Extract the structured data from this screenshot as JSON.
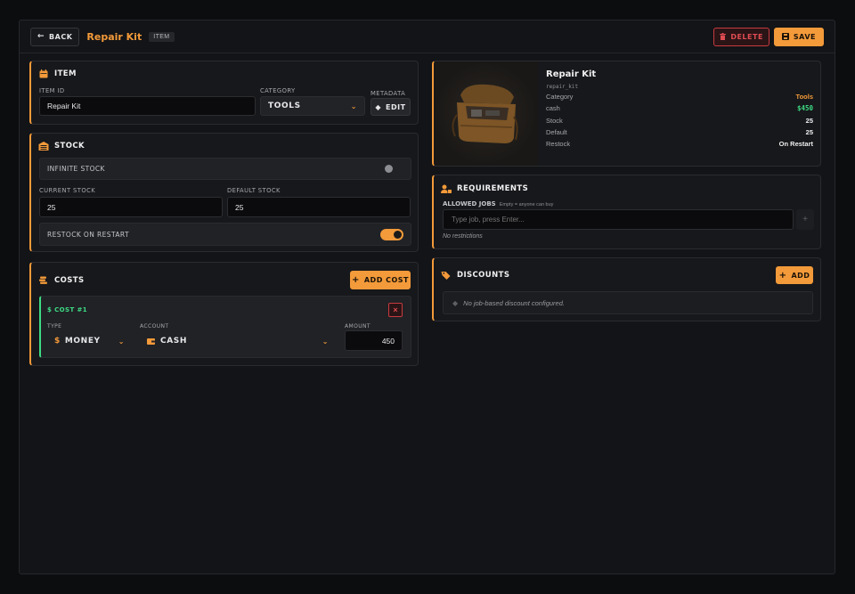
{
  "header": {
    "back_label": "BACK",
    "title": "Repair Kit",
    "tag": "ITEM",
    "delete_label": "DELETE",
    "save_label": "SAVE"
  },
  "item_panel": {
    "title": "ITEM",
    "item_id_label": "ITEM ID",
    "item_id_value": "Repair Kit",
    "category_label": "CATEGORY",
    "category_value": "TOOLS",
    "metadata_label": "METADATA",
    "edit_label": "EDIT"
  },
  "stock_panel": {
    "title": "STOCK",
    "infinite_label": "INFINITE STOCK",
    "infinite_enabled": false,
    "current_label": "CURRENT STOCK",
    "current_value": "25",
    "default_label": "DEFAULT STOCK",
    "default_value": "25",
    "restock_label": "RESTOCK ON RESTART",
    "restock_enabled": true
  },
  "costs_panel": {
    "title": "COSTS",
    "add_label": "ADD COST",
    "cost": {
      "title": "COST #1",
      "type_label": "TYPE",
      "type_value": "MONEY",
      "account_label": "ACCOUNT",
      "account_value": "CASH",
      "amount_label": "AMOUNT",
      "amount_value": "450"
    }
  },
  "preview": {
    "name": "Repair Kit",
    "code": "repair_kit",
    "rows": [
      {
        "key": "Category",
        "value": "Tools",
        "color": "#f39a3a"
      },
      {
        "key": "cash",
        "value": "$450",
        "color": "#3ddc84"
      },
      {
        "key": "Stock",
        "value": "25",
        "color": "#f0f0f2"
      },
      {
        "key": "Default",
        "value": "25",
        "color": "#f0f0f2"
      },
      {
        "key": "Restock",
        "value": "On Restart",
        "color": "#f0f0f2"
      }
    ]
  },
  "requirements": {
    "title": "REQUIREMENTS",
    "jobs_label": "ALLOWED JOBS",
    "jobs_hint": "Empty = anyone can buy",
    "jobs_placeholder": "Type job, press Enter...",
    "add_symbol": "+",
    "empty_note": "No restrictions"
  },
  "discounts": {
    "title": "DISCOUNTS",
    "add_label": "ADD",
    "empty_note": "No job-based discount configured."
  },
  "colors": {
    "accent": "#f39a3a",
    "success": "#3ddc84",
    "danger": "#e04c52"
  }
}
